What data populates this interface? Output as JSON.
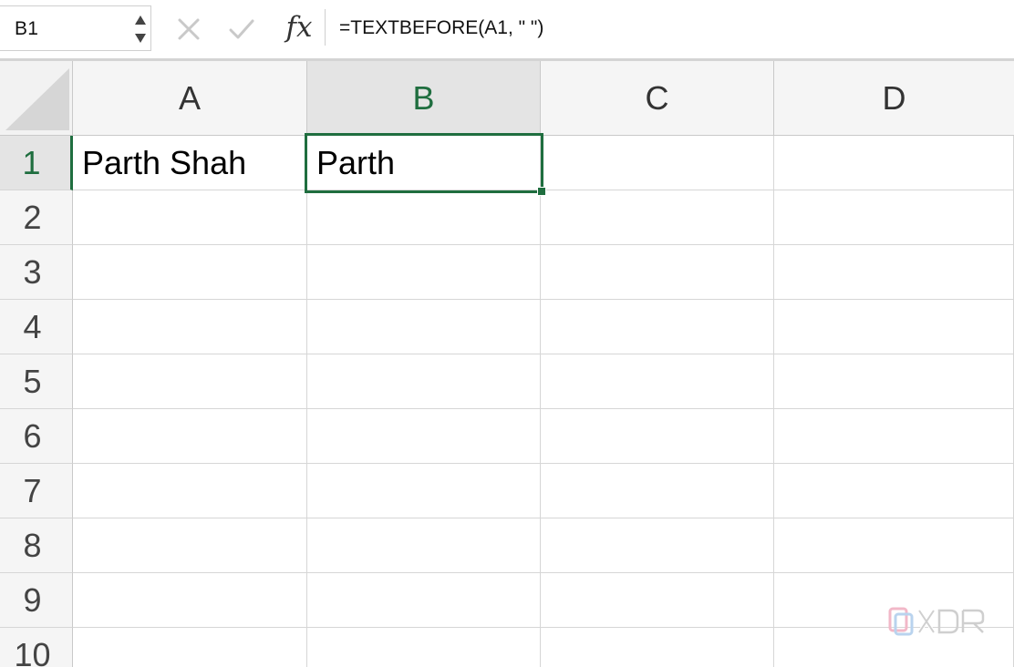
{
  "formula_bar": {
    "name_box": "B1",
    "fx_label": "fx",
    "formula": "=TEXTBEFORE(A1, \" \")"
  },
  "grid": {
    "columns": [
      "A",
      "B",
      "C",
      "D"
    ],
    "rows": [
      "1",
      "2",
      "3",
      "4",
      "5",
      "6",
      "7",
      "8",
      "9",
      "10"
    ],
    "active_cell": "B1",
    "selected_column": "B",
    "selected_row": "1",
    "cells": {
      "A1": "Parth Shah",
      "B1": "Parth"
    }
  },
  "colors": {
    "accent": "#1f6e3f",
    "gridline": "#d6d6d6",
    "header_bg": "#f5f5f5"
  },
  "watermark": {
    "brand": "XDA"
  }
}
